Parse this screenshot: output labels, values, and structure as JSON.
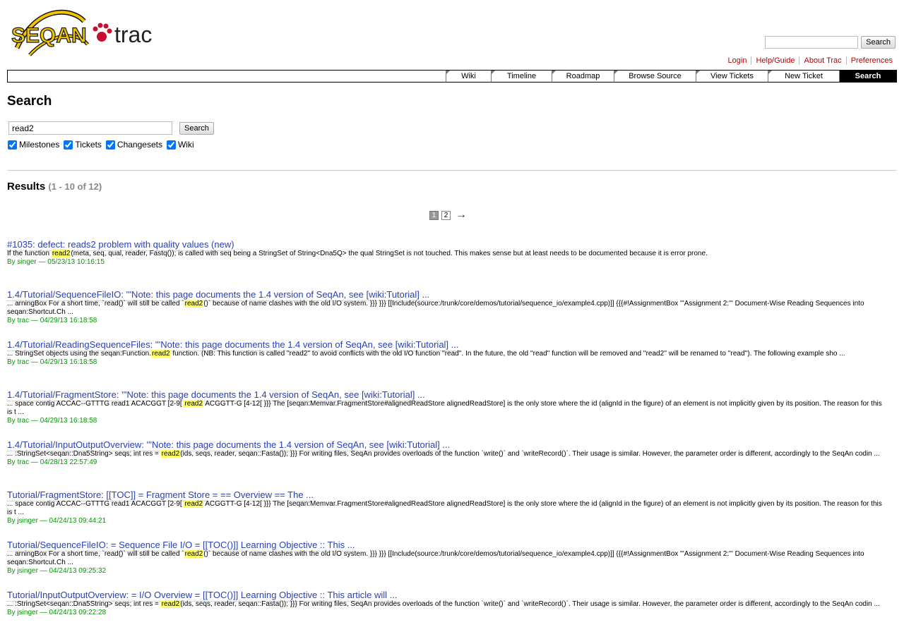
{
  "header": {
    "logo_text_left": "SEQAN",
    "logo_text_right": "trac",
    "top_search_button": "Search",
    "metanav": [
      "Login",
      "Help/Guide",
      "About Trac",
      "Preferences"
    ]
  },
  "mainnav": [
    {
      "label": "Wiki",
      "active": false
    },
    {
      "label": "Timeline",
      "active": false
    },
    {
      "label": "Roadmap",
      "active": false
    },
    {
      "label": "Browse Source",
      "active": false
    },
    {
      "label": "View Tickets",
      "active": false
    },
    {
      "label": "New Ticket",
      "active": false
    },
    {
      "label": "Search",
      "active": true
    }
  ],
  "search": {
    "title": "Search",
    "query": "read2",
    "button": "Search",
    "filters": [
      {
        "label": "Milestones",
        "checked": true
      },
      {
        "label": "Tickets",
        "checked": true
      },
      {
        "label": "Changesets",
        "checked": true
      },
      {
        "label": "Wiki",
        "checked": true
      }
    ]
  },
  "results_header": {
    "label": "Results",
    "count": "(1 - 10 of 12)"
  },
  "paging": {
    "pages": [
      "1",
      "2"
    ],
    "current": "1",
    "next": "→"
  },
  "results": [
    {
      "title": "#1035: defect: reads2 problem with quality values (new)",
      "excerpt_before": "If the function ",
      "excerpt_hl": "read2",
      "excerpt_after": "(meta, seq, qual, reader, Fastq()); is called with seq being a StringSet of String<Dna5Q> the qual StringSet is not touched. This makes sense but at least needs to be documented because it is error prone.",
      "author": "singer",
      "date": "05/23/13 10:16:15"
    },
    {
      "title": "1.4/Tutorial/SequenceFileIO: '''Note: this page documents the 1.4 version of SeqAn, see [wiki:Tutorial] ...",
      "excerpt_before": "... arningBox For a short time, `read()` will still be called `",
      "excerpt_hl": "read2",
      "excerpt_after": "()` because of name clashes with the old I/O system. }}} }}} [[Include(source:/trunk/core/demos/tutorial/sequence_io/example4.cpp)]] {{{#!AssignmentBox '''Assignment 2:''' Document-Wise Reading Sequences into seqan:Shortcut.Ch ...",
      "author": "trac",
      "date": "04/29/13 16:18:58"
    },
    {
      "title": "1.4/Tutorial/ReadingSequenceFiles: '''Note: this page documents the 1.4 version of SeqAn, see [wiki:Tutorial] ...",
      "excerpt_before": "... StringSet objects using the seqan:Function.",
      "excerpt_hl": "read2",
      "excerpt_after": " function. (NB: This function is called ''read2'' to avoid conflicts with the old I/O function ''read''. In the future, the old ''read'' function will be removed and ''read2'' will be renamed to ''read''). The following example sho ...",
      "author": "trac",
      "date": "04/29/13 16:18:58"
    },
    {
      "title": "1.4/Tutorial/FragmentStore: '''Note: this page documents the 1.4 version of SeqAn, see [wiki:Tutorial] ...",
      "excerpt_before": "... space contig ACCAC--GTTTG read1 ACACGGT [2-9[ ",
      "excerpt_hl": "read2",
      "excerpt_after": " ACGGTT-G [4-12[ }}} The [seqan:Memvar.FragmentStore#alignedReadStore alignedReadStore] is the only store where the id (alignId in the figure) of an element is not implicitly given by its position. The reason for this is t ...",
      "author": "trac",
      "date": "04/29/13 16:18:58"
    },
    {
      "title": "1.4/Tutorial/InputOutputOverview: '''Note: this page documents the 1.4 version of SeqAn, see [wiki:Tutorial] ...",
      "excerpt_before": "... :StringSet<seqan::Dna5String> seqs; int res = ",
      "excerpt_hl": "read2",
      "excerpt_after": "(ids, seqs, reader, seqan::Fasta()); }}} For writing files, SeqAn provides overloads of the function `write()` and `writeRecord()`. Their usage is similar. However, the parameter order is different, accordingly to the SeqAn codin ...",
      "author": "trac",
      "date": "04/28/13 22:57:49"
    },
    {
      "title": "Tutorial/FragmentStore: [[TOC]] = Fragment Store = == Overview == The ...",
      "excerpt_before": "... space contig ACCAC--GTTTG read1 ACACGGT [2-9[ ",
      "excerpt_hl": "read2",
      "excerpt_after": " ACGGTT-G [4-12[ }}} The [seqan:Memvar.FragmentStore#alignedReadStore alignedReadStore] is the only store where the id (alignId in the figure) of an element is not implicitly given by its position. The reason for this is t ...",
      "author": "jsinger",
      "date": "04/24/13 09:44:21"
    },
    {
      "title": "Tutorial/SequenceFileIO: = Sequence File I/O = [[TOC()]] Learning Objective :: This ...",
      "excerpt_before": "... arningBox For a short time, `read()` will still be called `",
      "excerpt_hl": "read2",
      "excerpt_after": "()` because of name clashes with the old I/O system. }}} }}} [[Include(source:/trunk/core/demos/tutorial/sequence_io/example4.cpp)]] {{{#!AssignmentBox '''Assignment 2:''' Document-Wise Reading Sequences into seqan:Shortcut.Ch ...",
      "author": "jsinger",
      "date": "04/24/13 09:25:32"
    },
    {
      "title": "Tutorial/InputOutputOverview: = I/O Overview = [[TOC()]] Learning Objective :: This article will ...",
      "excerpt_before": "... :StringSet<seqan::Dna5String> seqs; int res = ",
      "excerpt_hl": "read2",
      "excerpt_after": "(ids, seqs, reader, seqan::Fasta()); }}} For writing files, SeqAn provides overloads of the function `write()` and `writeRecord()`. Their usage is similar. However, the parameter order is different, accordingly to the SeqAn codin ...",
      "author": "jsinger",
      "date": "04/24/13 09:22:28"
    }
  ],
  "labels": {
    "by": "By",
    "dash": "—"
  },
  "colors": {
    "link": "#2940b8",
    "meta": "#009900",
    "highlight": "#ffff66",
    "metanav": "#bb0000",
    "logo_yellow": "#f2c500",
    "logo_red": "#c8102e"
  }
}
